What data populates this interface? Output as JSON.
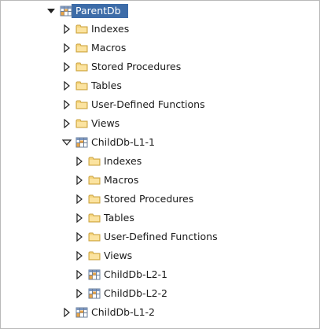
{
  "tree": {
    "root": {
      "label": "ParentDb",
      "expanded": true
    },
    "parent_children": [
      {
        "label": "Indexes",
        "type": "folder"
      },
      {
        "label": "Macros",
        "type": "folder"
      },
      {
        "label": "Stored Procedures",
        "type": "folder"
      },
      {
        "label": "Tables",
        "type": "folder"
      },
      {
        "label": "User-Defined Functions",
        "type": "folder"
      },
      {
        "label": "Views",
        "type": "folder"
      }
    ],
    "child1": {
      "label": "ChildDb-L1-1",
      "expanded": true
    },
    "child1_children": [
      {
        "label": "Indexes",
        "type": "folder"
      },
      {
        "label": "Macros",
        "type": "folder"
      },
      {
        "label": "Stored Procedures",
        "type": "folder"
      },
      {
        "label": "Tables",
        "type": "folder"
      },
      {
        "label": "User-Defined Functions",
        "type": "folder"
      },
      {
        "label": "Views",
        "type": "folder"
      },
      {
        "label": "ChildDb-L2-1",
        "type": "database"
      },
      {
        "label": "ChildDb-L2-2",
        "type": "database"
      }
    ],
    "child2": {
      "label": "ChildDb-L1-2",
      "expanded": false
    }
  },
  "colors": {
    "selection": "#3d6ca8",
    "folder_fill": "#f6d57c",
    "folder_stroke": "#c9a241",
    "db_grid": "#6b7f9a"
  }
}
